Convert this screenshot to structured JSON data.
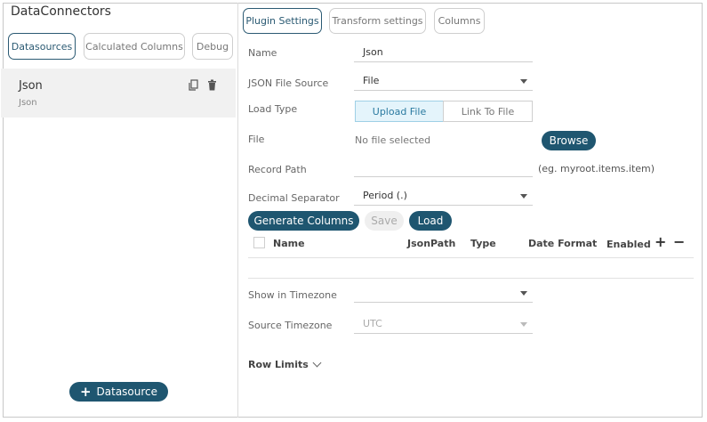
{
  "app": {
    "title": "DataConnectors"
  },
  "left_tabs": {
    "datasources": "Datasources",
    "calculated": "Calculated Columns",
    "debug": "Debug"
  },
  "datasource_list": [
    {
      "name": "Json",
      "type": "Json"
    }
  ],
  "add_datasource": {
    "label": "Datasource"
  },
  "right_tabs": {
    "plugin": "Plugin Settings",
    "transform": "Transform settings",
    "columns": "Columns"
  },
  "form": {
    "name_label": "Name",
    "name_value": "Json",
    "source_label": "JSON File Source",
    "source_value": "File",
    "load_type_label": "Load Type",
    "upload_file": "Upload File",
    "link_to_file": "Link To File",
    "file_label": "File",
    "file_value": "No file selected",
    "browse": "Browse",
    "record_path_label": "Record Path",
    "record_path_value": "",
    "record_path_hint": "(eg. myroot.items.item)",
    "decimal_label": "Decimal Separator",
    "decimal_value": "Period (.)"
  },
  "actions": {
    "generate": "Generate Columns",
    "save": "Save",
    "load": "Load"
  },
  "columns_table": {
    "headers": [
      "Name",
      "JsonPath",
      "Type",
      "Date Format",
      "Enabled"
    ]
  },
  "timezone": {
    "show_label": "Show in Timezone",
    "show_value": "",
    "source_label": "Source Timezone",
    "source_value": "UTC"
  },
  "row_limits": {
    "label": "Row Limits"
  }
}
